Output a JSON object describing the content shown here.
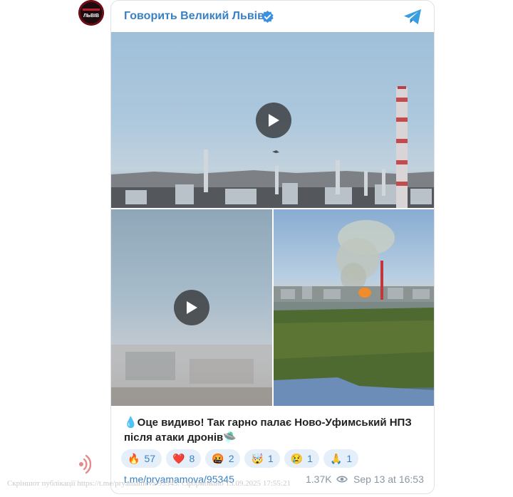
{
  "channel": {
    "avatar_text": "ЛЬВІВ",
    "name": "Говорить Великий Львів",
    "verified_icon": "verified-badge-icon",
    "telegram_icon": "telegram-logo-icon"
  },
  "media": [
    {
      "kind": "video",
      "description_icon": "play-icon"
    },
    {
      "kind": "video",
      "description_icon": "play-icon"
    },
    {
      "kind": "photo"
    }
  ],
  "post": {
    "text": "💧Оце видиво! Так гарно палає Ново-Уфимський НПЗ після атаки дронів🛸"
  },
  "reactions": [
    {
      "emoji": "🔥",
      "count": "57"
    },
    {
      "emoji": "❤️",
      "count": "8"
    },
    {
      "emoji": "🤬",
      "count": "2"
    },
    {
      "emoji": "🤯",
      "count": "1"
    },
    {
      "emoji": "😢",
      "count": "1"
    },
    {
      "emoji": "🙏",
      "count": "1"
    }
  ],
  "footer": {
    "link": "t.me/pryamamova/95345",
    "views": "1.37K",
    "date": "Sep 13 at 16:53"
  },
  "screenshot_note": "Скріншот публікації https://t.me/pryamamova/95345. Сформовано 13.09.2025 17:55:21",
  "colors": {
    "accent": "#3a80c4",
    "reaction_bg": "#e4effa",
    "muted": "#8a96a3"
  }
}
